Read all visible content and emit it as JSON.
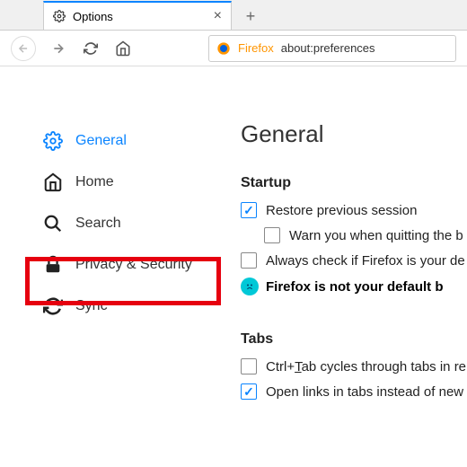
{
  "tab": {
    "title": "Options"
  },
  "urlbar": {
    "brand": "Firefox",
    "url": "about:preferences"
  },
  "sidebar": {
    "general": "General",
    "home": "Home",
    "search": "Search",
    "privacy": "Privacy & Security",
    "sync": "Sync"
  },
  "main": {
    "heading": "General",
    "startup": {
      "title": "Startup",
      "restore": "Restore previous session",
      "warn": "Warn you when quitting the b",
      "always": "Always check if Firefox is your de",
      "notdefault": "Firefox is not your default b"
    },
    "tabs": {
      "title": "Tabs",
      "ctrl_pre": "Ctrl+",
      "ctrl_u": "T",
      "ctrl_post": "ab cycles through tabs in re",
      "open": "Open links in tabs instead of new"
    }
  }
}
